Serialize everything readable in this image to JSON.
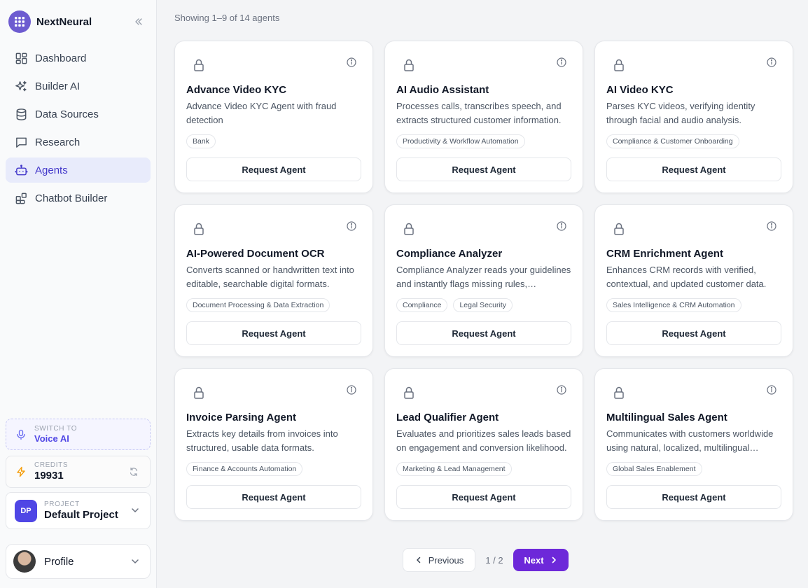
{
  "brand": {
    "name": "NextNeural",
    "logo_icon": "grid-icon",
    "collapse_icon": "double-chevron-left-icon"
  },
  "sidebar": {
    "items": [
      {
        "label": "Dashboard",
        "icon": "dashboard-icon",
        "active": false
      },
      {
        "label": "Builder AI",
        "icon": "sparkles-icon",
        "active": false
      },
      {
        "label": "Data Sources",
        "icon": "database-icon",
        "active": false
      },
      {
        "label": "Research",
        "icon": "chat-icon",
        "active": false
      },
      {
        "label": "Agents",
        "icon": "bot-icon",
        "active": true
      },
      {
        "label": "Chatbot Builder",
        "icon": "blocks-icon",
        "active": false
      }
    ],
    "switch": {
      "caption": "SWITCH TO",
      "value": "Voice AI",
      "icon": "microphone-icon"
    },
    "credits": {
      "caption": "CREDITS",
      "value": "19931",
      "icon": "lightning-icon",
      "refresh_icon": "refresh-icon"
    },
    "project": {
      "badge": "DP",
      "caption": "PROJECT",
      "name": "Default Project"
    },
    "profile": {
      "label": "Profile"
    }
  },
  "main": {
    "showing": "Showing 1–9 of 14 agents",
    "request_label": "Request Agent",
    "agents": [
      {
        "title": "Advance Video KYC",
        "desc": "Advance Video KYC Agent with fraud detection",
        "tags": [
          "Bank"
        ]
      },
      {
        "title": "AI Audio Assistant",
        "desc": "Processes calls, transcribes speech, and extracts structured customer information.",
        "tags": [
          "Productivity & Workflow Automation"
        ]
      },
      {
        "title": "AI Video KYC",
        "desc": "Parses KYC videos, verifying identity through facial and audio analysis.",
        "tags": [
          "Compliance & Customer Onboarding"
        ]
      },
      {
        "title": "AI-Powered Document OCR",
        "desc": "Converts scanned or handwritten text into editable, searchable digital formats.",
        "tags": [
          "Document Processing & Data Extraction"
        ]
      },
      {
        "title": "Compliance Analyzer",
        "desc": "Compliance Analyzer reads your guidelines and instantly flags missing rules,…",
        "tags": [
          "Compliance",
          "Legal Security"
        ]
      },
      {
        "title": "CRM Enrichment Agent",
        "desc": "Enhances CRM records with verified, contextual, and updated customer data.",
        "tags": [
          "Sales Intelligence & CRM Automation"
        ]
      },
      {
        "title": "Invoice Parsing Agent",
        "desc": "Extracts key details from invoices into structured, usable data formats.",
        "tags": [
          "Finance & Accounts Automation"
        ]
      },
      {
        "title": "Lead Qualifier Agent",
        "desc": "Evaluates and prioritizes sales leads based on engagement and conversion likelihood.",
        "tags": [
          "Marketing & Lead Management"
        ]
      },
      {
        "title": "Multilingual Sales Agent",
        "desc": "Communicates with customers worldwide using natural, localized, multilingual…",
        "tags": [
          "Global Sales Enablement"
        ]
      }
    ]
  },
  "pagination": {
    "prev": "Previous",
    "page": "1 / 2",
    "next": "Next"
  },
  "colors": {
    "accent": "#6d28d9",
    "active_bg": "#e8ebfb",
    "brand_logo": "#6d5bd0",
    "project_badge": "#4f46e5"
  }
}
